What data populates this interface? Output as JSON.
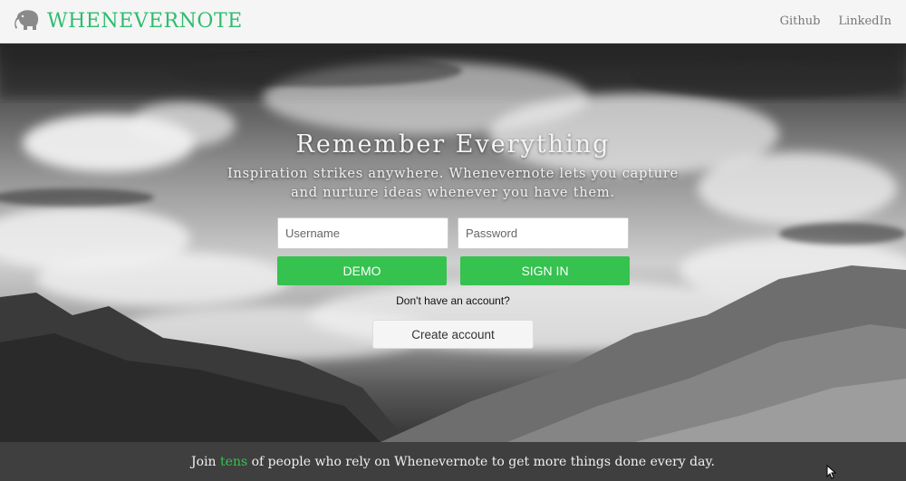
{
  "navbar": {
    "brand": "WHENEVERNOTE",
    "links": [
      "Github",
      "LinkedIn"
    ]
  },
  "hero": {
    "title": "Remember Everything",
    "subtitle": "Inspiration strikes anywhere. Whenevernote lets you capture and nurture ideas whenever you have them."
  },
  "login": {
    "username_placeholder": "Username",
    "password_placeholder": "Password",
    "demo_label": "DEMO",
    "signin_label": "SIGN IN",
    "no_account_text": "Don't have an account?",
    "create_label": "Create account"
  },
  "footer": {
    "prefix": "Join ",
    "highlight": "tens",
    "suffix": " of people who rely on Whenevernote to get more things done every day."
  },
  "colors": {
    "brand_green": "#2dbd6e",
    "button_green": "#35c24f",
    "footer_bg": "#3f3f3f"
  },
  "icons": {
    "logo": "elephant-icon",
    "cursor": "mouse-cursor-icon"
  }
}
